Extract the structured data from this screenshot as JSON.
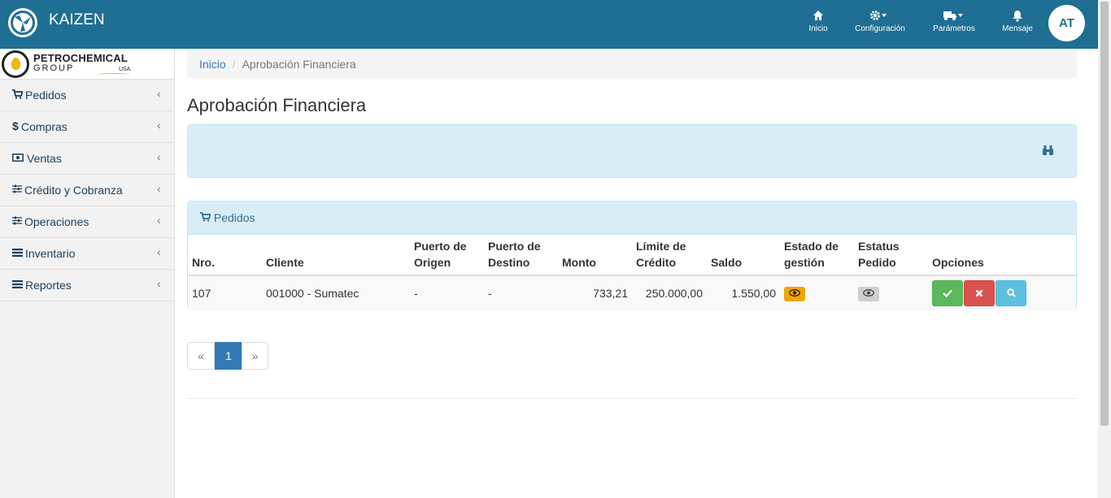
{
  "app": {
    "name": "KAIZEN",
    "logo_icon": "kaizen-logo-icon"
  },
  "topnav": [
    {
      "label": "Inicio",
      "icon": "home-icon"
    },
    {
      "label": "Configuración",
      "icon": "gear-icon"
    },
    {
      "label": "Parámetros",
      "icon": "truck-icon"
    },
    {
      "label": "Mensaje",
      "icon": "bell-icon"
    }
  ],
  "user": {
    "initials": "AT"
  },
  "company_logo": {
    "line1": "PETROCHEMICAL",
    "line2": "GROUP",
    "line3": "USA"
  },
  "sidebar": {
    "items": [
      {
        "label": "Pedidos",
        "icon": "cart-icon"
      },
      {
        "label": "Compras",
        "icon": "dollar-icon"
      },
      {
        "label": "Ventas",
        "icon": "money-icon"
      },
      {
        "label": "Crédito y Cobranza",
        "icon": "sliders-icon"
      },
      {
        "label": "Operaciones",
        "icon": "sliders-icon"
      },
      {
        "label": "Inventario",
        "icon": "list-icon"
      },
      {
        "label": "Reportes",
        "icon": "list-icon"
      }
    ]
  },
  "breadcrumb": {
    "home": "Inicio",
    "current": "Aprobación Financiera"
  },
  "page": {
    "title": "Aprobación Financiera"
  },
  "orders_panel": {
    "title": "Pedidos",
    "columns": [
      "Nro.",
      "Cliente",
      "Puerto de Origen",
      "Puerto de Destino",
      "Monto",
      "Límite de Crédito",
      "Saldo",
      "Estado de gestión",
      "Estatus Pedido",
      "Opciones"
    ],
    "rows": [
      {
        "nro": "107",
        "cliente": "001000 - Sumatec",
        "origen": "-",
        "destino": "-",
        "monto": "733,21",
        "limite": "250.000,00",
        "saldo": "1.550,00"
      }
    ]
  },
  "pagination": {
    "prev": "«",
    "current": "1",
    "next": "»"
  },
  "colors": {
    "topbar": "#1e6f93",
    "info": "#d9edf7",
    "primary": "#337ab7",
    "success": "#5cb85c",
    "danger": "#d9534f",
    "info_btn": "#5bc0de",
    "warning": "#f0ad4e"
  }
}
